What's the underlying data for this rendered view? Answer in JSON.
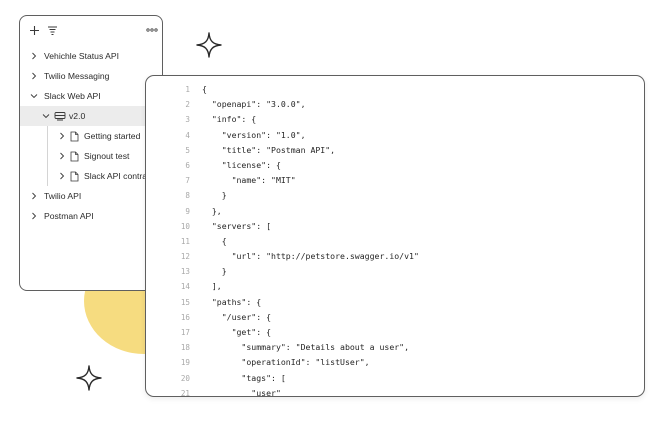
{
  "sidebar": {
    "toolbar": {
      "add_icon": "plus-icon",
      "filter_icon": "filter-icon",
      "more_icon": "more-horizontal-icon"
    },
    "items": [
      {
        "label": "Vehichle Status API",
        "expanded": false
      },
      {
        "label": "Twilio Messaging",
        "expanded": false
      },
      {
        "label": "Slack Web API",
        "expanded": true
      },
      {
        "label": "v2.0",
        "expanded": true,
        "selected": true
      },
      {
        "label": "Getting started",
        "expanded": false
      },
      {
        "label": "Signout test",
        "expanded": false
      },
      {
        "label": "Slack API contract",
        "expanded": false
      },
      {
        "label": "Twilio API",
        "expanded": false
      },
      {
        "label": "Postman API",
        "expanded": false
      }
    ]
  },
  "editor": {
    "lines": [
      {
        "n": "1",
        "text": "{"
      },
      {
        "n": "2",
        "text": "  \"openapi\": \"3.0.0\","
      },
      {
        "n": "3",
        "text": "  \"info\": {"
      },
      {
        "n": "4",
        "text": "    \"version\": \"1.0\","
      },
      {
        "n": "5",
        "text": "    \"title\": \"Postman API\","
      },
      {
        "n": "6",
        "text": "    \"license\": {"
      },
      {
        "n": "7",
        "text": "      \"name\": \"MIT\""
      },
      {
        "n": "8",
        "text": "    }"
      },
      {
        "n": "9",
        "text": "  },"
      },
      {
        "n": "10",
        "text": "  \"servers\": ["
      },
      {
        "n": "11",
        "text": "    {"
      },
      {
        "n": "12",
        "text": "      \"url\": \"http://petstore.swagger.io/v1\""
      },
      {
        "n": "13",
        "text": "    }"
      },
      {
        "n": "14",
        "text": "  ],"
      },
      {
        "n": "15",
        "text": "  \"paths\": {"
      },
      {
        "n": "16",
        "text": "    \"/user\": {"
      },
      {
        "n": "17",
        "text": "      \"get\": {"
      },
      {
        "n": "18",
        "text": "        \"summary\": \"Details about a user\","
      },
      {
        "n": "19",
        "text": "        \"operationId\": \"listUser\","
      },
      {
        "n": "20",
        "text": "        \"tags\": ["
      },
      {
        "n": "21",
        "text": "          \"user\""
      }
    ]
  },
  "colors": {
    "blob": "#f6dc80",
    "border": "#5f5f5f",
    "selected_row": "#ececec",
    "line_number": "#a9a9a9"
  }
}
